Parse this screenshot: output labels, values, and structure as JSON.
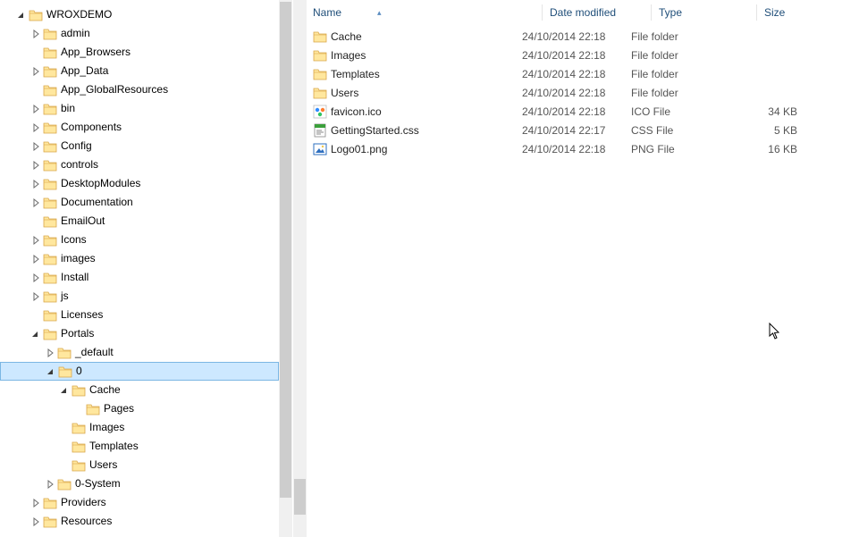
{
  "columns": {
    "name": "Name",
    "date": "Date modified",
    "type": "Type",
    "size": "Size"
  },
  "tree": [
    {
      "depth": 0,
      "exp": "open",
      "label": "WROXDEMO",
      "selected": false
    },
    {
      "depth": 1,
      "exp": "closed",
      "label": "admin",
      "selected": false
    },
    {
      "depth": 1,
      "exp": "none",
      "label": "App_Browsers",
      "selected": false
    },
    {
      "depth": 1,
      "exp": "closed",
      "label": "App_Data",
      "selected": false
    },
    {
      "depth": 1,
      "exp": "none",
      "label": "App_GlobalResources",
      "selected": false
    },
    {
      "depth": 1,
      "exp": "closed",
      "label": "bin",
      "selected": false
    },
    {
      "depth": 1,
      "exp": "closed",
      "label": "Components",
      "selected": false
    },
    {
      "depth": 1,
      "exp": "closed",
      "label": "Config",
      "selected": false
    },
    {
      "depth": 1,
      "exp": "closed",
      "label": "controls",
      "selected": false
    },
    {
      "depth": 1,
      "exp": "closed",
      "label": "DesktopModules",
      "selected": false
    },
    {
      "depth": 1,
      "exp": "closed",
      "label": "Documentation",
      "selected": false
    },
    {
      "depth": 1,
      "exp": "none",
      "label": "EmailOut",
      "selected": false
    },
    {
      "depth": 1,
      "exp": "closed",
      "label": "Icons",
      "selected": false
    },
    {
      "depth": 1,
      "exp": "closed",
      "label": "images",
      "selected": false
    },
    {
      "depth": 1,
      "exp": "closed",
      "label": "Install",
      "selected": false
    },
    {
      "depth": 1,
      "exp": "closed",
      "label": "js",
      "selected": false
    },
    {
      "depth": 1,
      "exp": "none",
      "label": "Licenses",
      "selected": false
    },
    {
      "depth": 1,
      "exp": "open",
      "label": "Portals",
      "selected": false
    },
    {
      "depth": 2,
      "exp": "closed",
      "label": "_default",
      "selected": false
    },
    {
      "depth": 2,
      "exp": "open",
      "label": "0",
      "selected": true
    },
    {
      "depth": 3,
      "exp": "open",
      "label": "Cache",
      "selected": false
    },
    {
      "depth": 4,
      "exp": "none",
      "label": "Pages",
      "selected": false
    },
    {
      "depth": 3,
      "exp": "none",
      "label": "Images",
      "selected": false
    },
    {
      "depth": 3,
      "exp": "none",
      "label": "Templates",
      "selected": false
    },
    {
      "depth": 3,
      "exp": "none",
      "label": "Users",
      "selected": false
    },
    {
      "depth": 2,
      "exp": "closed",
      "label": "0-System",
      "selected": false
    },
    {
      "depth": 1,
      "exp": "closed",
      "label": "Providers",
      "selected": false
    },
    {
      "depth": 1,
      "exp": "closed",
      "label": "Resources",
      "selected": false
    }
  ],
  "files": [
    {
      "icon": "folder",
      "name": "Cache",
      "date": "24/10/2014 22:18",
      "type": "File folder",
      "size": ""
    },
    {
      "icon": "folder",
      "name": "Images",
      "date": "24/10/2014 22:18",
      "type": "File folder",
      "size": ""
    },
    {
      "icon": "folder",
      "name": "Templates",
      "date": "24/10/2014 22:18",
      "type": "File folder",
      "size": ""
    },
    {
      "icon": "folder",
      "name": "Users",
      "date": "24/10/2014 22:18",
      "type": "File folder",
      "size": ""
    },
    {
      "icon": "ico",
      "name": "favicon.ico",
      "date": "24/10/2014 22:18",
      "type": "ICO File",
      "size": "34 KB"
    },
    {
      "icon": "css",
      "name": "GettingStarted.css",
      "date": "24/10/2014 22:17",
      "type": "CSS File",
      "size": "5 KB"
    },
    {
      "icon": "png",
      "name": "Logo01.png",
      "date": "24/10/2014 22:18",
      "type": "PNG File",
      "size": "16 KB"
    }
  ]
}
